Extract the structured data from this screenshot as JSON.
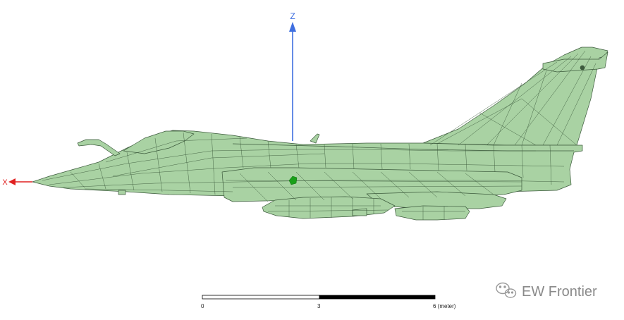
{
  "axes": {
    "z_label": "Z",
    "x_label": "X",
    "z_color": "#3f6fe0",
    "x_color": "#e02020"
  },
  "model": {
    "fill_color": "#a9d2a3",
    "edge_color": "#3c5a3c",
    "marker_color": "#19a019"
  },
  "scale_bar": {
    "ticks": [
      "0",
      "3",
      "6 (meter)"
    ],
    "colors": [
      "#ffffff",
      "#000000"
    ]
  },
  "watermark": {
    "text": "EW Frontier",
    "icon": "wechat-icon"
  }
}
